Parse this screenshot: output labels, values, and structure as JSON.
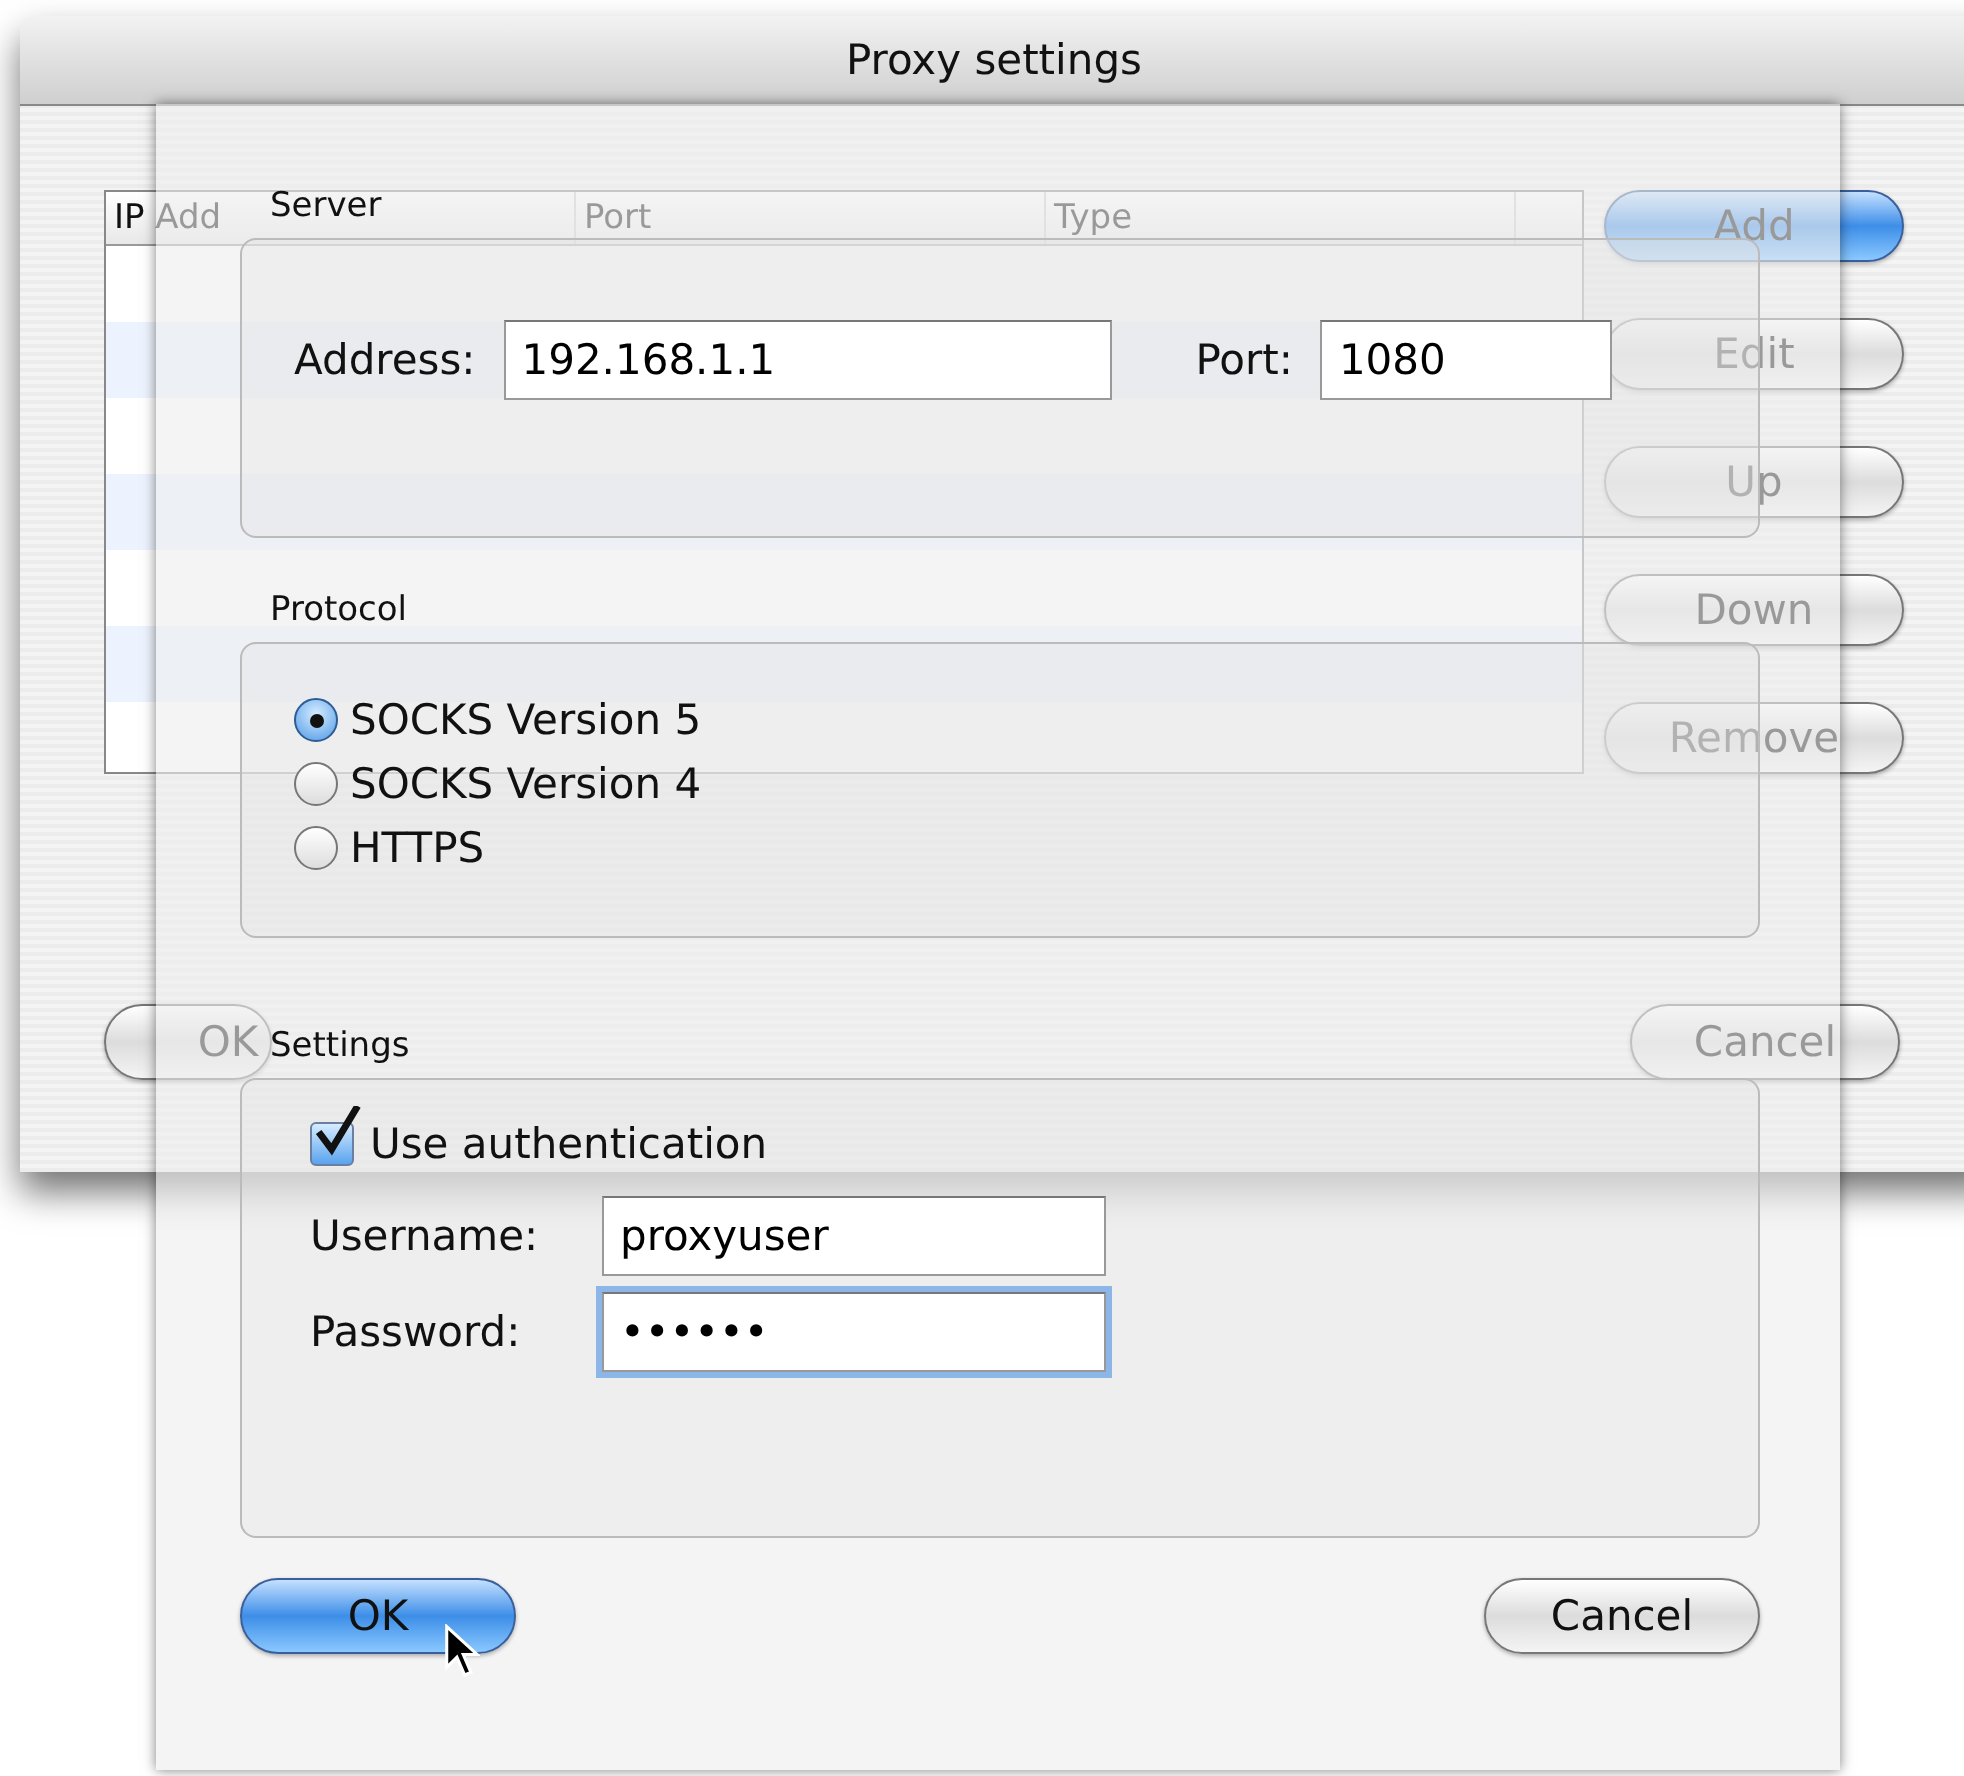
{
  "window": {
    "title": "Proxy settings"
  },
  "background": {
    "table": {
      "columns": [
        "IP Add",
        "Port",
        "Type"
      ]
    },
    "side_buttons": [
      {
        "label": "Add",
        "default": true
      },
      {
        "label": "Edit",
        "default": false
      },
      {
        "label": "Up",
        "default": false
      },
      {
        "label": "Down",
        "default": false
      },
      {
        "label": "Remove",
        "default": false
      }
    ],
    "buttons": [
      {
        "label": "OK",
        "default": false
      },
      {
        "label": "Cancel",
        "default": false
      }
    ]
  },
  "sheet": {
    "server": {
      "label": "Server",
      "address_label": "Address:",
      "address": "192.168.1.1",
      "port_label": "Port:",
      "port": "1080"
    },
    "protocol": {
      "label": "Protocol",
      "options": [
        {
          "label": "SOCKS Version 5",
          "selected": true
        },
        {
          "label": "SOCKS Version 4",
          "selected": false
        },
        {
          "label": "HTTPS",
          "selected": false
        }
      ]
    },
    "settings": {
      "label": "Settings",
      "use_authentication": {
        "label": "Use authentication",
        "checked": true
      },
      "username_label": "Username:",
      "username": "proxyuser",
      "username_focused": false,
      "password_label": "Password:",
      "password": "••••••",
      "password_focused": true
    },
    "buttons": [
      {
        "label": "OK",
        "default": true
      },
      {
        "label": "Cancel",
        "default": false
      }
    ]
  }
}
